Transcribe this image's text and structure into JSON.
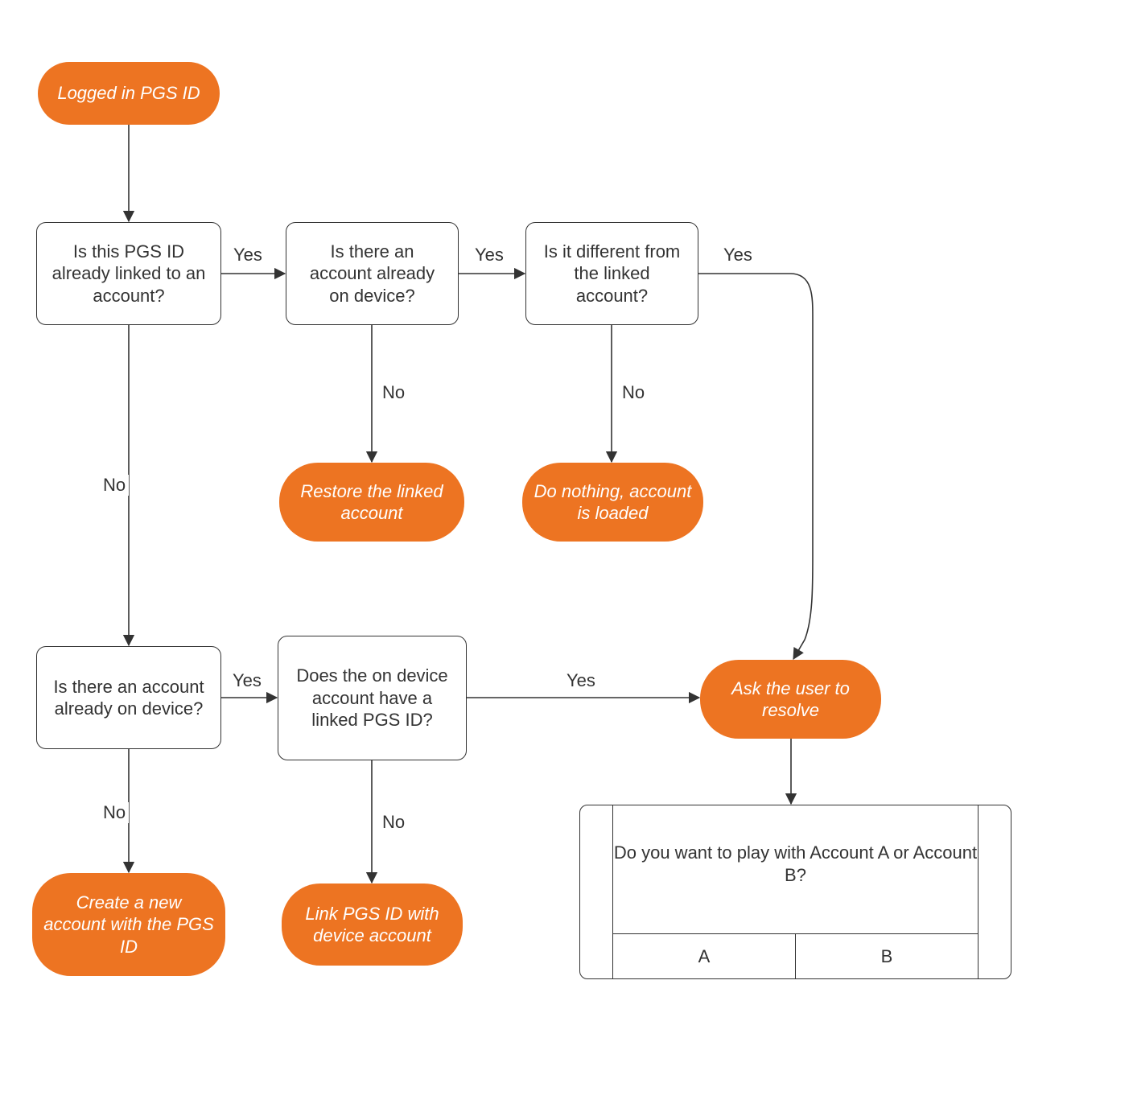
{
  "colors": {
    "accent": "#ed7422",
    "stroke": "#333333"
  },
  "nodes": {
    "start": "Logged in PGS ID",
    "d1": "Is this PGS ID already linked to an account?",
    "d2": "Is there an account already on device?",
    "d3": "Is it different from the linked account?",
    "a_restore": "Restore the linked account",
    "a_nothing": "Do nothing, account is loaded",
    "d4": "Is there an account already on device?",
    "d5": "Does the on device account have a linked PGS ID?",
    "a_create": "Create a new account with the PGS  ID",
    "a_link": "Link PGS ID with device account",
    "a_ask": "Ask the user to resolve",
    "dialog_q": "Do you want to play with Account A or Account B?",
    "dialog_a": "A",
    "dialog_b": "B"
  },
  "edges": {
    "yes": "Yes",
    "no": "No"
  }
}
